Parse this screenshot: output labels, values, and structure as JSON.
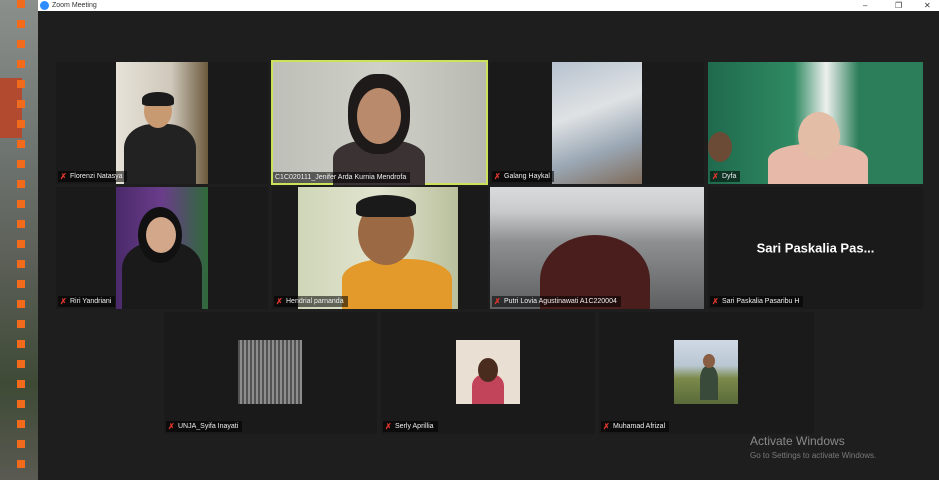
{
  "window": {
    "title": "Zoom Meeting",
    "minimize": "–",
    "maximize": "❐",
    "close": "✕"
  },
  "participants": [
    {
      "name": "Florenzi Natasya",
      "muted": true
    },
    {
      "name": "C1C020111_Jenifer Arda Kurnia Mendrofa",
      "muted": false,
      "speaking": true
    },
    {
      "name": "Galang Haykal",
      "muted": true
    },
    {
      "name": "Dyfa",
      "muted": true
    },
    {
      "name": "Riri Yandriani",
      "muted": true
    },
    {
      "name": "Hendrial parnanda",
      "muted": true
    },
    {
      "name": "Putri Lovia Agustinawati A1C220004",
      "muted": true
    },
    {
      "name": "Sari Paskalia Pasaribu H",
      "muted": true,
      "display": "Sari Paskalia Pas..."
    },
    {
      "name": "UNJA_Syifa Inayati",
      "muted": true
    },
    {
      "name": "Serly Aprillia",
      "muted": true
    },
    {
      "name": "Muhamad Afrizal",
      "muted": true
    }
  ],
  "watermark": {
    "line1": "Activate Windows",
    "line2": "Go to Settings to activate Windows."
  },
  "colors": {
    "speaking_border": "#cde25a",
    "muted_icon": "#e0362c",
    "background": "#1e1e1e"
  }
}
